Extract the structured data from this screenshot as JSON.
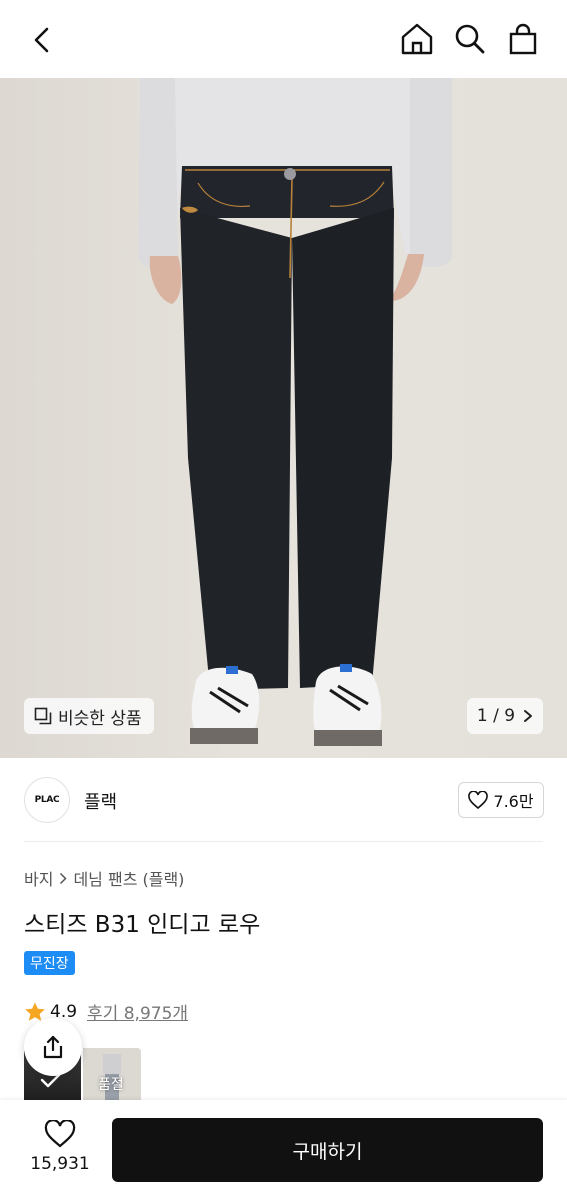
{
  "header": {
    "back_icon": "chevron-left-icon",
    "home_icon": "home-icon",
    "search_icon": "search-icon",
    "bag_icon": "shopping-bag-icon"
  },
  "hero": {
    "similar_label": "비슷한 상품",
    "counter_label": "1 / 9",
    "sweater_color": "#e2e2e4",
    "jeans_color": "#202328",
    "stitch_color": "#b8823a"
  },
  "brand": {
    "logo_text": "PLAC",
    "name": "플랙",
    "like_count": "7.6만"
  },
  "product": {
    "breadcrumb": [
      "바지",
      "데님 팬츠 (플랙)"
    ],
    "title": "스티즈 B31 인디고 로우",
    "tag": "무진장",
    "rating": "4.9",
    "review_label": "후기 8,975개",
    "soldout_label": "품절",
    "accent_color": "#1e8cf5",
    "star_color": "#f5a623"
  },
  "bottom": {
    "wish_count": "15,931",
    "buy_label": "구매하기"
  }
}
